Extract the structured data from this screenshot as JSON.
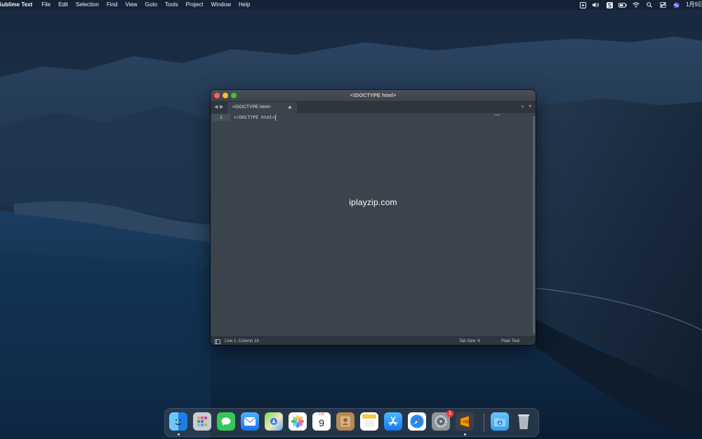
{
  "menubar": {
    "app_name": "Sublime Text",
    "items": [
      "File",
      "Edit",
      "Selection",
      "Find",
      "View",
      "Goto",
      "Tools",
      "Project",
      "Window",
      "Help"
    ],
    "clock": "1月9日"
  },
  "window": {
    "title": "<!DOCTYPE html>",
    "tab_label": "<!DOCTYPE html>",
    "line_number": "1",
    "code": "<!DOCTYPE html>",
    "watermark": "iplayzip.com",
    "status": {
      "cursor_position": "Line 1, Column 16",
      "tab_size": "Tab Size: 4",
      "syntax": "Plain Text"
    }
  },
  "dock": {
    "calendar_month": "1月",
    "calendar_day": "9",
    "settings_badge": "1",
    "apps": [
      "finder",
      "launchpad",
      "messages",
      "mail",
      "maps",
      "photos",
      "calendar",
      "contacts",
      "notes",
      "app-store",
      "safari",
      "system-preferences",
      "sublime-text",
      "downloads",
      "trash"
    ]
  },
  "colors": {
    "close": "#fe5f57",
    "minimize": "#febc2e",
    "maximize": "#28c840",
    "editor_bg": "#3b434d",
    "caret": "#f2c744"
  }
}
